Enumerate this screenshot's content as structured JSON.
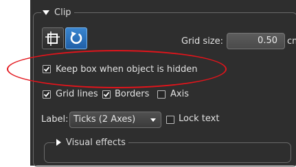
{
  "clip_group": {
    "title": "Clip",
    "collapse_icon": "triangle-down-icon"
  },
  "toolbar": {
    "crop_icon": "crop-box-icon",
    "reset_icon": "rotate-reset-icon"
  },
  "grid_size": {
    "label": "Grid size:",
    "value": "0.50",
    "unit": "cm"
  },
  "options": {
    "keep_box": {
      "label": "Keep box when object is hidden",
      "checked": true
    },
    "grid_lines": {
      "label": "Grid lines",
      "checked": true
    },
    "borders": {
      "label": "Borders",
      "checked": true
    },
    "axis": {
      "label": "Axis",
      "checked": false
    },
    "lock_text": {
      "label": "Lock text",
      "checked": false
    }
  },
  "label_select": {
    "label": "Label:",
    "value": "Ticks (2 Axes)"
  },
  "visual_effects": {
    "title": "Visual effects",
    "expand_icon": "triangle-right-icon"
  },
  "annotation": {
    "color": "#e3141b"
  }
}
